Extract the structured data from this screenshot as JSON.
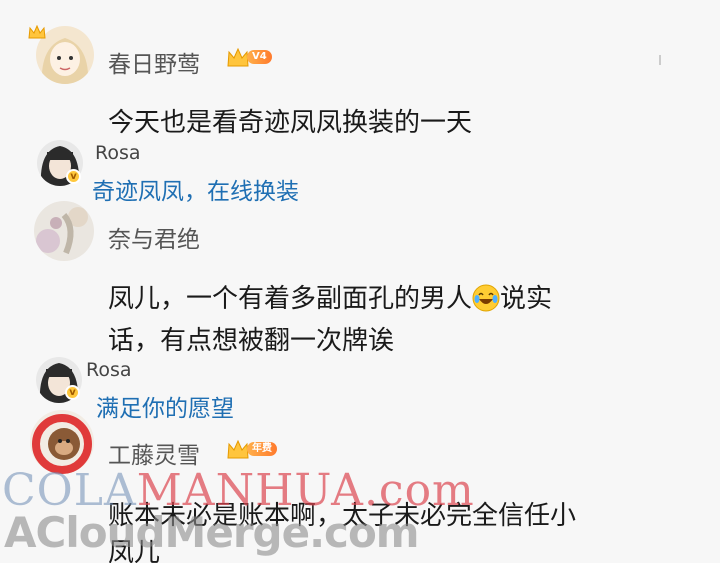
{
  "comments": [
    {
      "user": "春日野莺",
      "level_badge": "V4",
      "text": "今天也是看奇迹凤凤换装的一天",
      "reply": {
        "user": "Rosa",
        "text": "奇迹凤凤，在线换装"
      }
    },
    {
      "user": "奈与君绝",
      "text_line1": "凤儿，一个有着多副面孔的男人",
      "text_line1_after": "说实",
      "text_line2": "话，有点想被翻一次牌诶",
      "emoji": "laughing-tears-icon",
      "reply": {
        "user": "Rosa",
        "text": "满足你的愿望"
      }
    },
    {
      "user": "工藤灵雪",
      "level_badge": "年费",
      "text_line1": "账本未必是账本啊，太子未必完全信任小",
      "text_line2": "凤儿"
    }
  ],
  "watermark": {
    "line1_a": "COLA",
    "line1_b": "MANHUA",
    "line1_c": ".com",
    "line2": "ACloudMerge.com"
  },
  "colors": {
    "reply_text": "#1f6fb3",
    "badge_gold": "#ffc83d"
  }
}
